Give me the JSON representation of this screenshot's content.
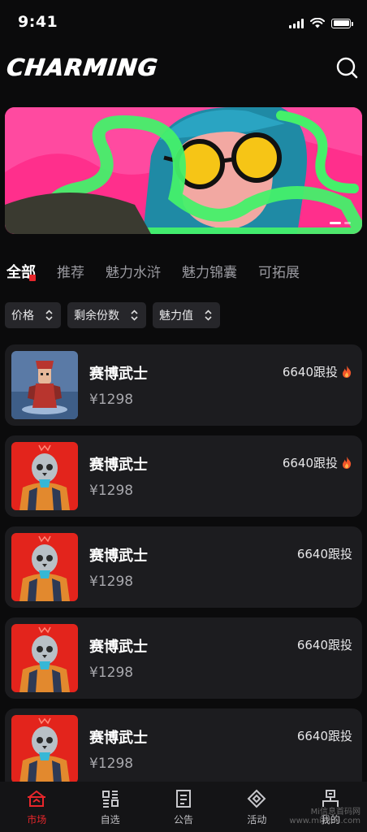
{
  "status": {
    "time": "9:41"
  },
  "header": {
    "logo": "CHARMING",
    "search_icon": "search-icon"
  },
  "banner": {
    "image": "banner-illustration"
  },
  "categories": [
    {
      "label": "全部",
      "active": true
    },
    {
      "label": "推荐",
      "active": false
    },
    {
      "label": "魅力水浒",
      "active": false
    },
    {
      "label": "魅力锦囊",
      "active": false
    },
    {
      "label": "可拓展",
      "active": false
    }
  ],
  "filters": [
    {
      "label": "价格"
    },
    {
      "label": "剩余份数"
    },
    {
      "label": "魅力值"
    }
  ],
  "items": [
    {
      "name": "赛博武士",
      "price": "¥1298",
      "follow": "6640跟投",
      "hot": true,
      "image": "warrior-thumbnail"
    },
    {
      "name": "赛博武士",
      "price": "¥1298",
      "follow": "6640跟投",
      "hot": true,
      "image": "skull-robot-thumbnail"
    },
    {
      "name": "赛博武士",
      "price": "¥1298",
      "follow": "6640跟投",
      "hot": false,
      "image": "skull-robot-thumbnail"
    },
    {
      "name": "赛博武士",
      "price": "¥1298",
      "follow": "6640跟投",
      "hot": false,
      "image": "skull-robot-thumbnail"
    },
    {
      "name": "赛博武士",
      "price": "¥1298",
      "follow": "6640跟投",
      "hot": false,
      "image": "skull-robot-thumbnail"
    }
  ],
  "tabbar": [
    {
      "label": "市场",
      "icon": "market-icon",
      "active": true
    },
    {
      "label": "自选",
      "icon": "watchlist-icon",
      "active": false
    },
    {
      "label": "公告",
      "icon": "notice-icon",
      "active": false
    },
    {
      "label": "活动",
      "icon": "activity-icon",
      "active": false
    },
    {
      "label": "我的",
      "icon": "profile-icon",
      "active": false
    }
  ],
  "watermark": {
    "line1": "Mi信息首码网",
    "line2": "www.mixinxi.com"
  },
  "colors": {
    "accent": "#e8262b",
    "background": "#0b0b0c",
    "card": "#1c1c1f",
    "filter": "#26262a",
    "banner": "#ff2f8c"
  }
}
